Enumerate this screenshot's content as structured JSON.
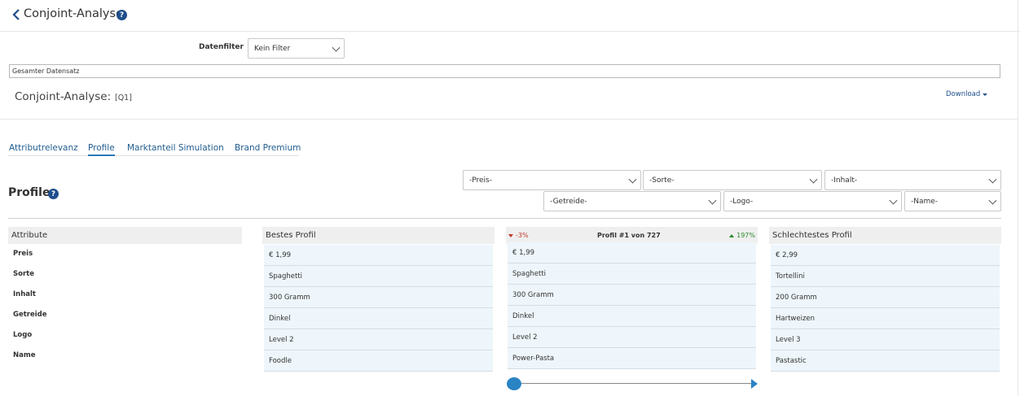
{
  "header": {
    "title": "Conjoint-Analyse",
    "help_glyph": "?"
  },
  "filter": {
    "label": "Datenfilter",
    "selected": "Kein Filter"
  },
  "dataset": "Gesamter Datensatz",
  "analysis": {
    "title": "Conjoint-Analyse:",
    "subtitle": "[Q1]",
    "download_label": "Download"
  },
  "tabs": [
    {
      "label": "Attributrelevanz",
      "active": false
    },
    {
      "label": "Profile",
      "active": true
    },
    {
      "label": "Marktanteil Simulation",
      "active": false
    },
    {
      "label": "Brand Premium",
      "active": false
    }
  ],
  "profile": {
    "title": "Profile",
    "help_glyph": "?",
    "dropdowns": [
      "-Preis-",
      "-Sorte-",
      "-Inhalt-",
      "-Getreide-",
      "-Logo-",
      "-Name-"
    ]
  },
  "table": {
    "attribute_header": "Attribute",
    "attributes": [
      "Preis",
      "Sorte",
      "Inhalt",
      "Getreide",
      "Logo",
      "Name"
    ],
    "best": {
      "header": "Bestes Profil",
      "values": [
        "€ 1,99",
        "Spaghetti",
        "300 Gramm",
        "Dinkel",
        "Level 2",
        "Foodle"
      ]
    },
    "current": {
      "header": "Profil #1 von 727",
      "delta_down": "-3%",
      "delta_up": "197%",
      "values": [
        "€ 1,99",
        "Spaghetti",
        "300 Gramm",
        "Dinkel",
        "Level 2",
        "Power-Pasta"
      ]
    },
    "worst": {
      "header": "Schlechtestes Profil",
      "values": [
        "€ 2,99",
        "Tortellini",
        "200 Gramm",
        "Hartweizen",
        "Level 3",
        "Pastastic"
      ]
    }
  },
  "slider": {
    "position": 1,
    "total": 727
  },
  "colors": {
    "accent": "#1f4e8c",
    "tab_text": "#1f5c8f",
    "slider": "#2a84c4",
    "cell_bg": "#eef6fb",
    "negative": "#c0392b",
    "positive": "#2a8a2a"
  }
}
